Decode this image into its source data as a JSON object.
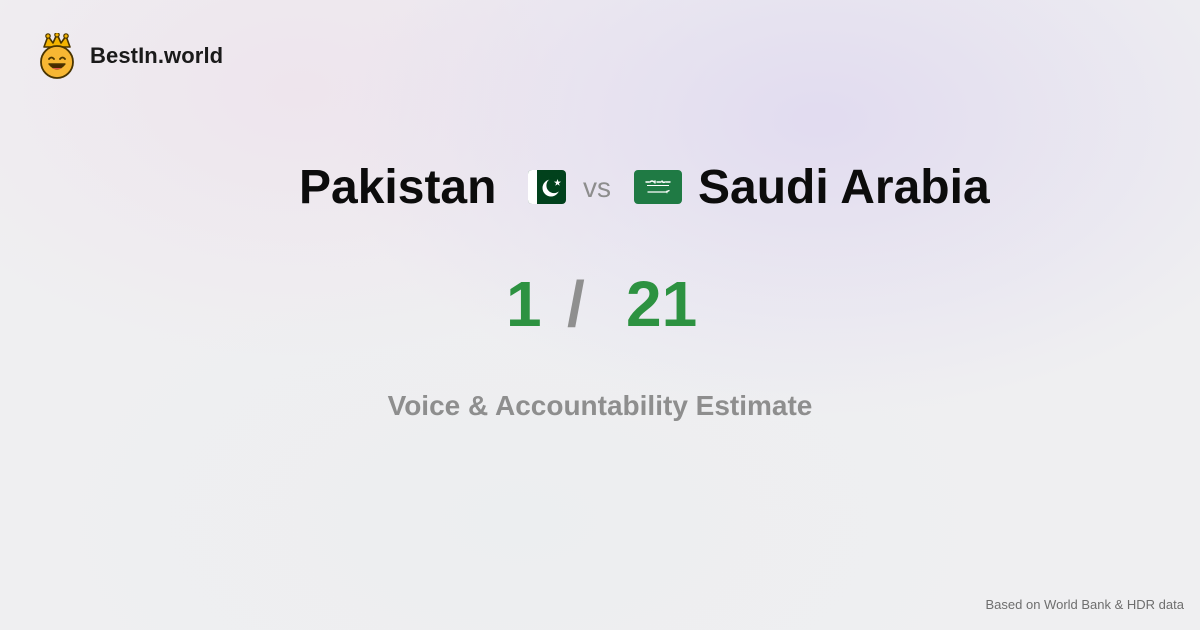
{
  "brand": {
    "name": "BestIn.world",
    "logo_icon": "crowned-smiley-icon"
  },
  "comparison": {
    "country_a": "Pakistan",
    "country_b": "Saudi Arabia",
    "vs_label": "vs",
    "flag_a_icon": "pakistan-flag-icon",
    "flag_b_icon": "saudi-arabia-flag-icon",
    "rank_a": "1",
    "rank_separator": "/",
    "rank_b": "21",
    "metric": "Voice & Accountability Estimate"
  },
  "footer": {
    "source": "Based on World Bank & HDR data"
  },
  "colors": {
    "rank_green": "#2d9241",
    "pakistan_green": "#01411c",
    "saudi_green": "#1f7a44",
    "muted_gray": "#8e8e8e"
  }
}
